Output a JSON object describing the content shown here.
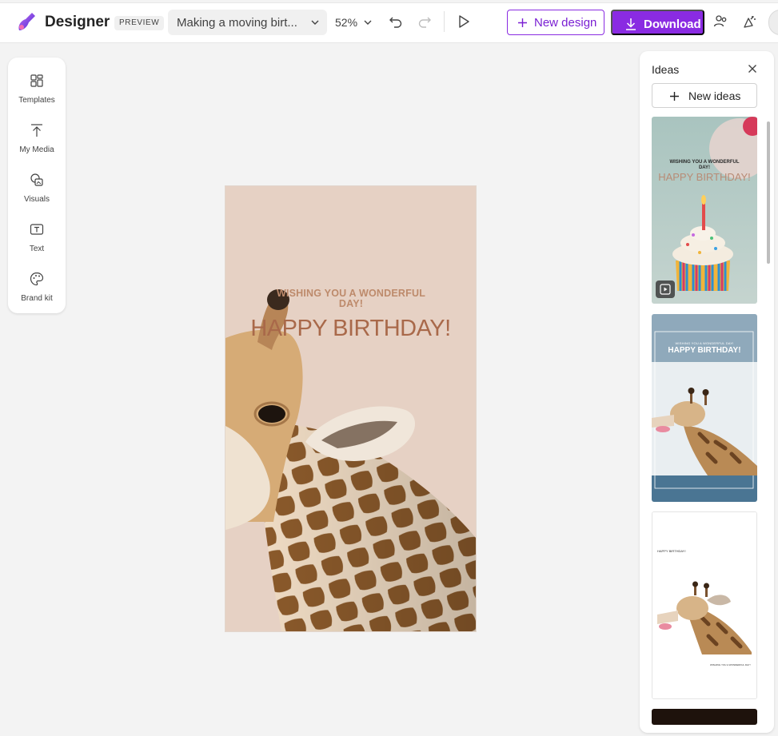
{
  "app": {
    "name": "Designer",
    "badge": "PREVIEW",
    "document_title": "Making a moving birt...",
    "zoom": "52%"
  },
  "toolbar": {
    "new_design_label": "New design",
    "download_label": "Download",
    "accent_color": "#8a2be2"
  },
  "sidebar": {
    "items": [
      {
        "label": "Templates",
        "icon": "templates-icon"
      },
      {
        "label": "My Media",
        "icon": "upload-icon"
      },
      {
        "label": "Visuals",
        "icon": "visuals-icon"
      },
      {
        "label": "Text",
        "icon": "text-icon"
      },
      {
        "label": "Brand kit",
        "icon": "palette-icon"
      }
    ]
  },
  "canvas": {
    "subtitle": "WISHING YOU A WONDERFUL DAY!",
    "headline": "HAPPY BIRTHDAY!",
    "background_color": "#e6d1c4"
  },
  "ideas": {
    "title": "Ideas",
    "new_ideas_label": "New ideas",
    "cards": [
      {
        "subtitle": "WISHING YOU A WONDERFUL DAY!",
        "headline": "HAPPY BIRTHDAY!",
        "is_video": true
      },
      {
        "subtitle": "WISHING YOU A WONDERFUL DAY!",
        "headline": "HAPPY BIRTHDAY!"
      },
      {
        "headline": "HAPPY BIRTHDAY!",
        "subtitle": "WISHING YOU A WONDERFUL DAY!"
      },
      {}
    ]
  }
}
